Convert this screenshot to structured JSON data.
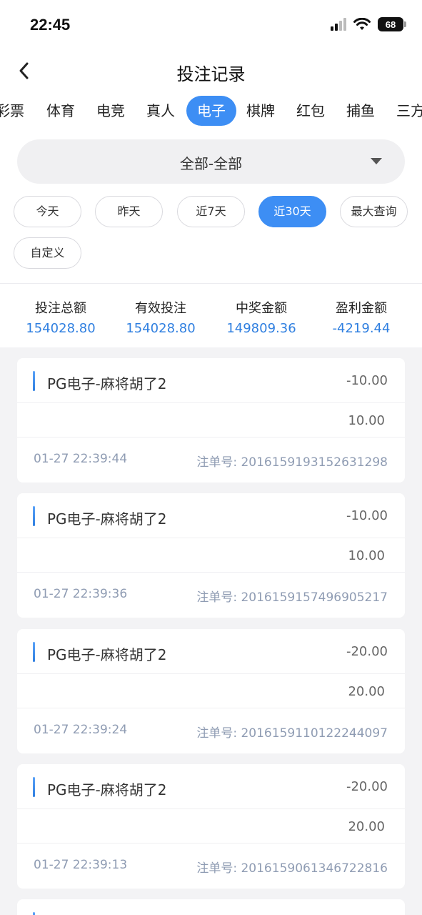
{
  "status": {
    "time": "22:45",
    "battery": "68"
  },
  "header": {
    "title": "投注记录"
  },
  "tabs": [
    {
      "label": "彩票"
    },
    {
      "label": "体育"
    },
    {
      "label": "电竞"
    },
    {
      "label": "真人"
    },
    {
      "label": "电子",
      "active": true
    },
    {
      "label": "棋牌"
    },
    {
      "label": "红包"
    },
    {
      "label": "捕鱼"
    },
    {
      "label": "三方"
    }
  ],
  "filter": {
    "selected": "全部-全部"
  },
  "date_chips": [
    {
      "label": "今天"
    },
    {
      "label": "昨天"
    },
    {
      "label": "近7天"
    },
    {
      "label": "近30天",
      "active": true
    },
    {
      "label": "最大查询"
    },
    {
      "label": "自定义"
    }
  ],
  "summary": [
    {
      "label": "投注总额",
      "value": "154028.80"
    },
    {
      "label": "有效投注",
      "value": "154028.80"
    },
    {
      "label": "中奖金额",
      "value": "149809.36"
    },
    {
      "label": "盈利金额",
      "value": "-4219.44"
    }
  ],
  "records": [
    {
      "title": "PG电子-麻将胡了2",
      "profit": "-10.00",
      "bet": "10.00",
      "time": "01-27 22:39:44",
      "order_label": "注单号:",
      "order_no": "2016159193152631298"
    },
    {
      "title": "PG电子-麻将胡了2",
      "profit": "-10.00",
      "bet": "10.00",
      "time": "01-27 22:39:36",
      "order_label": "注单号:",
      "order_no": "2016159157496905217"
    },
    {
      "title": "PG电子-麻将胡了2",
      "profit": "-20.00",
      "bet": "20.00",
      "time": "01-27 22:39:24",
      "order_label": "注单号:",
      "order_no": "2016159110122244097"
    },
    {
      "title": "PG电子-麻将胡了2",
      "profit": "-20.00",
      "bet": "20.00",
      "time": "01-27 22:39:13",
      "order_label": "注单号:",
      "order_no": "2016159061346722816"
    }
  ]
}
